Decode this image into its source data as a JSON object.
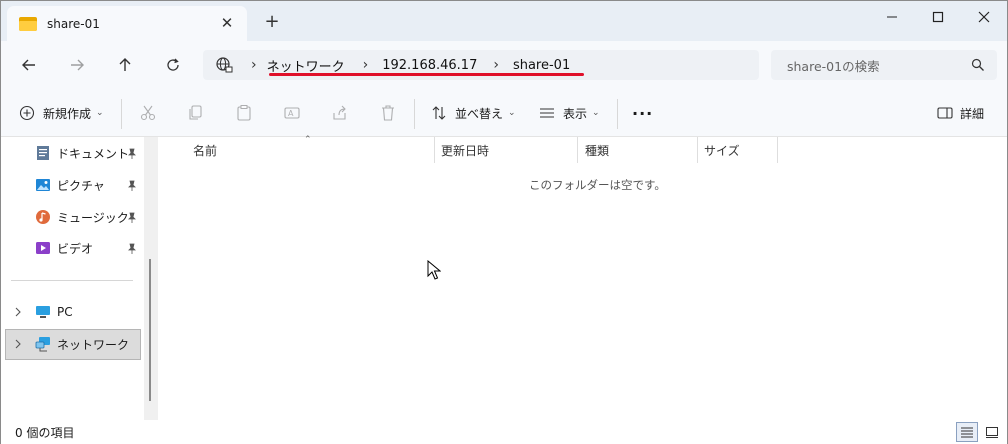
{
  "tab": {
    "title": "share-01",
    "close": "✕",
    "new": "+"
  },
  "window_controls": {
    "minimize": "minimize",
    "maximize": "maximize",
    "close": "close"
  },
  "address": {
    "crumbs": [
      "ネットワーク",
      "192.168.46.17",
      "share-01"
    ],
    "separator": "›"
  },
  "search": {
    "placeholder": "share-01の検索"
  },
  "command_bar": {
    "new_label": "新規作成",
    "sort_label": "並べ替え",
    "view_label": "表示",
    "more_label": "···",
    "details_label": "詳細"
  },
  "sidebar": {
    "pinned": [
      {
        "label": "ドキュメント",
        "icon": "document-icon"
      },
      {
        "label": "ピクチャ",
        "icon": "pictures-icon"
      },
      {
        "label": "ミュージック",
        "icon": "music-icon"
      },
      {
        "label": "ビデオ",
        "icon": "video-icon"
      }
    ],
    "tree": [
      {
        "label": "PC",
        "icon": "pc-icon"
      },
      {
        "label": "ネットワーク",
        "icon": "network-icon",
        "selected": true
      }
    ]
  },
  "columns": {
    "name": "名前",
    "modified": "更新日時",
    "type": "種類",
    "size": "サイズ"
  },
  "content": {
    "empty_message": "このフォルダーは空です。"
  },
  "status": {
    "item_count": "0 個の項目"
  },
  "colors": {
    "accent_red": "#e0102a",
    "selected_bg": "#dcdcdc",
    "chrome_bg": "#f7f9fc"
  }
}
